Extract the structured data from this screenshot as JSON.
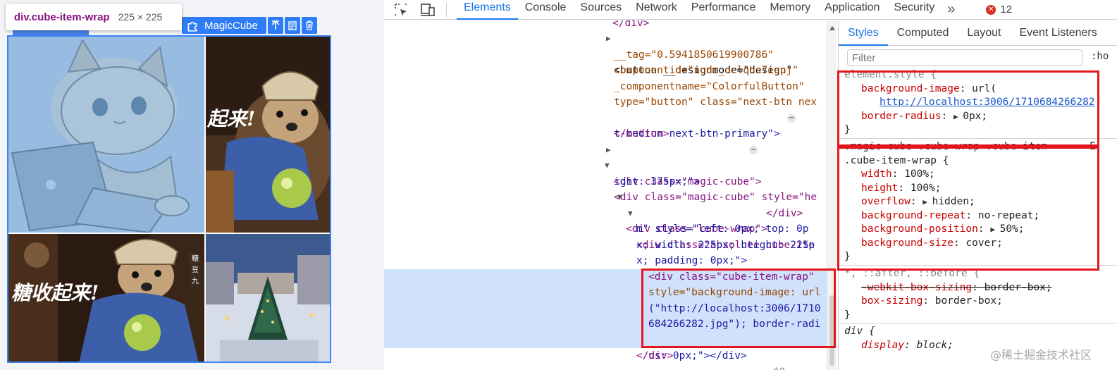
{
  "preview": {
    "tooltip_selector": "div.cube-item-wrap",
    "tooltip_dims": "225 × 225",
    "component_label": "MagicCube",
    "cube_images": [
      {
        "caption": "起来!"
      },
      {
        "caption": "糖收起来!"
      },
      {
        "vertical_text": "糖豆九"
      }
    ]
  },
  "devtools": {
    "tool_icons": [
      "inspect-icon",
      "device-toggle-icon"
    ],
    "tabs": [
      "Elements",
      "Console",
      "Sources",
      "Network",
      "Performance",
      "Memory",
      "Application",
      "Security"
    ],
    "active_tab": "Elements",
    "more_tabs": "»",
    "error_count": "12",
    "dom_lines": [
      "</div>",
      "<button __designmode=\"design\"",
      "__tag=\"0.5941850619900786\"",
      "componentid=\"node_oclqhs7eapj\"",
      "_componentname=\"ColorfulButton\"",
      "type=\"button\" class=\"next-btn nex",
      "t-medium next-btn-primary\">",
      "</button>",
      "<div class=\"magic-cube\">",
      "<div class=\"magic-cube\" style=\"he",
      "ight: 375px;\">",
      "<div class=\"cube-wrap\">",
      "<div class=\"absolute cube-ite",
      "m\" style=\"left: 0px; top: 0p",
      "x; width: 225px; height: 225p",
      "x; padding: 0px;\">",
      "<div class=\"cube-item-wrap\"",
      "style=\"background-image: url",
      "(\"http://localhost:3006/1710",
      "684266282.jpg\"); border-radi",
      "us: 0px;\"></div>",
      "== $0",
      "</div>"
    ],
    "ellipsis": "⋯",
    "styles_tabs": [
      "Styles",
      "Computed",
      "Layout",
      "Event Listeners"
    ],
    "active_styles_tab": "Styles",
    "filter_placeholder": "Filter",
    "filter_tail": ":ho",
    "rules": {
      "element_style": {
        "selector": "element.style {",
        "prop1": "background-image",
        "val1_prefix": "url(",
        "val1_url": "http://localhost:3006/1710684266282",
        "prop2": "border-radius",
        "val2": "0px;",
        "close": "}"
      },
      "cube_rule": {
        "selector_line1": ".magic-cube .cube-wrap .cube-item",
        "selector_line2": ".cube-item-wrap {",
        "source": "E:",
        "decls": [
          {
            "prop": "width",
            "val": "100%;"
          },
          {
            "prop": "height",
            "val": "100%;"
          },
          {
            "prop": "overflow",
            "val": "hidden;"
          },
          {
            "prop": "background-repeat",
            "val": "no-repeat;"
          },
          {
            "prop": "background-position",
            "val": "50%;"
          },
          {
            "prop": "background-size",
            "val": "cover;"
          }
        ],
        "close": "}"
      },
      "universal_rule": {
        "selector": "*, ::after, ::before {",
        "decls": [
          {
            "prop": "-webkit-box-sizing",
            "val": "border-box;"
          },
          {
            "prop": "box-sizing",
            "val": "border-box;"
          }
        ],
        "close": "}"
      },
      "div_rule": {
        "selector": "div {",
        "prop": "display",
        "val": "block;"
      }
    },
    "watermark": "@稀土掘金技术社区"
  },
  "colors": {
    "accent": "#1a73e8",
    "annotation_red": "#e3151d",
    "highlight_blue": "#cfe1fb",
    "tag_purple": "#881280",
    "attr_name": "#994500",
    "attr_value": "#1a1aa6",
    "css_prop": "#c80000",
    "overlay_blue": "#6fa8dc"
  }
}
